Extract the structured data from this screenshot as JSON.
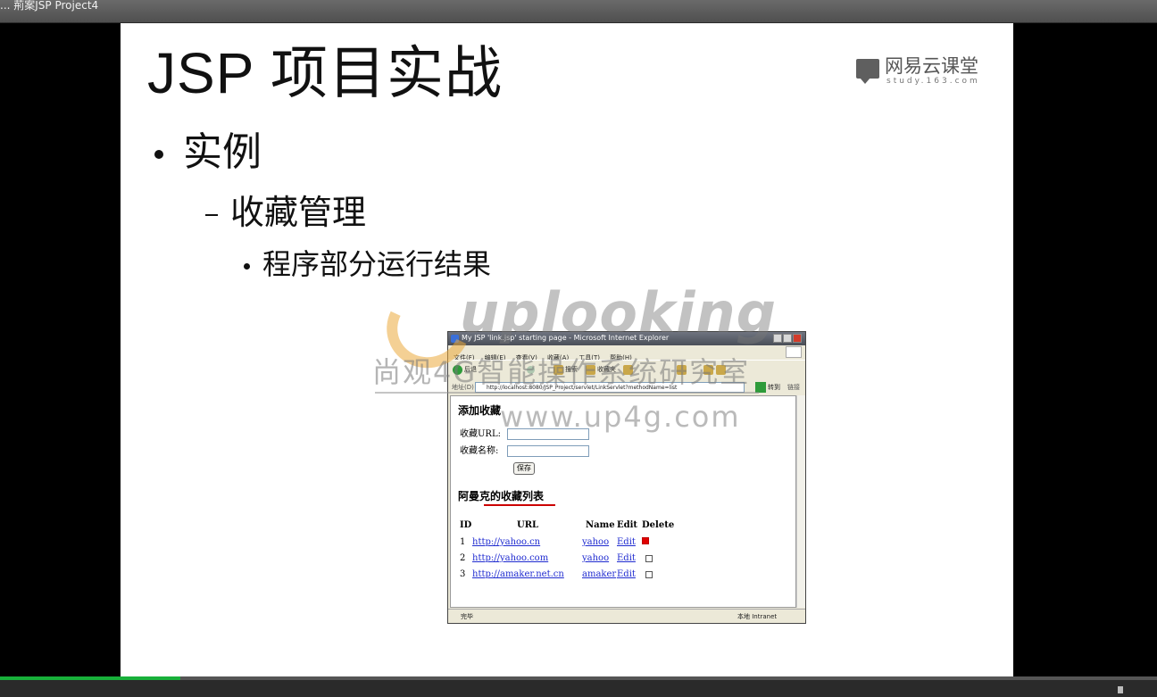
{
  "window": {
    "title": "... 荊案JSP Project4"
  },
  "slide": {
    "title": "JSP 项目实战",
    "logo": {
      "name": "网易云课堂",
      "sub": "study.163.com"
    },
    "bullet1": "实例",
    "bullet2": "收藏管理",
    "bullet3": "程序部分运行结果"
  },
  "watermark": {
    "brand": "uplooking",
    "cn": "尚观4G智能操作系统研究室",
    "url": "www.up4g.com"
  },
  "ie": {
    "title": "My JSP 'link.jsp' starting page - Microsoft Internet Explorer",
    "menu": [
      "文件(F)",
      "编辑(E)",
      "查看(V)",
      "收藏(A)",
      "工具(T)",
      "帮助(H)"
    ],
    "toolbar": {
      "back": "后退",
      "search": "搜索",
      "favorites": "收藏夹"
    },
    "address_label": "地址(D)",
    "address": "http://localhost:8080/JSP_Project/servlet/LinkServlet?methodName=list",
    "go": "转到",
    "links": "链接",
    "status_left": "完毕",
    "status_right": "本地 Intranet"
  },
  "page": {
    "add_heading": "添加收藏",
    "url_label": "收藏URL:",
    "name_label": "收藏名称:",
    "save_label": "保存",
    "list_heading": "阿曼克的收藏列表",
    "columns": [
      "ID",
      "URL",
      "Name",
      "Edit",
      "Delete"
    ],
    "rows": [
      {
        "id": "1",
        "url": "http://yahoo.cn",
        "name": "yahoo",
        "edit": "Edit",
        "checked": true
      },
      {
        "id": "2",
        "url": "http://yahoo.com",
        "name": "yahoo",
        "edit": "Edit",
        "checked": false
      },
      {
        "id": "3",
        "url": "http://amaker.net.cn",
        "name": "amaker",
        "edit": "Edit",
        "checked": false
      }
    ]
  },
  "player": {
    "progress": 0.156
  },
  "colors": {
    "progress": "#18b03a",
    "link": "#1f2bd0",
    "underline": "#cc0000"
  }
}
